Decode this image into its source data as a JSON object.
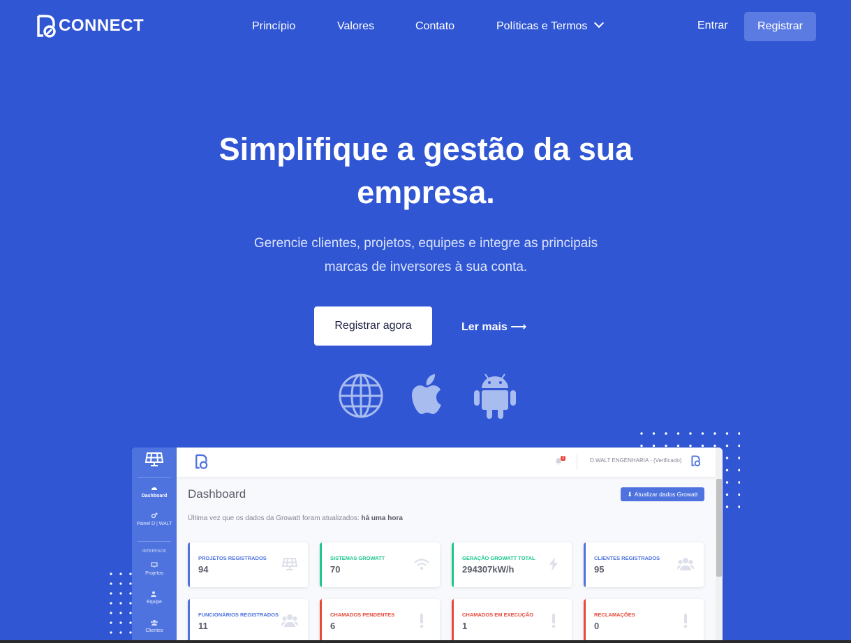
{
  "nav": {
    "logo_text": "CONNECT",
    "links": [
      "Princípio",
      "Valores",
      "Contato",
      "Políticas e Termos"
    ],
    "login_label": "Entrar",
    "register_label": "Registrar"
  },
  "hero": {
    "title_line1": "Simplifique a gestão da sua",
    "title_line2": "empresa.",
    "subtitle_line1": "Gerencie clientes, projetos, equipes e integre as principais",
    "subtitle_line2": "marcas de inversores à sua conta.",
    "cta_label": "Registrar agora",
    "more_label": "Ler mais ⟶",
    "platform_icons": [
      "globe-icon",
      "apple-icon",
      "android-icon"
    ]
  },
  "dashboard": {
    "sidebar": {
      "items": [
        {
          "label": "Dashboard",
          "icon": "gauge-icon"
        },
        {
          "label": "Painel D | WALT",
          "icon": "cogs-icon"
        }
      ],
      "heading": "INTERFACE",
      "interface_items": [
        {
          "label": "Projetos",
          "icon": "solar-panel-icon"
        },
        {
          "label": "Equipe",
          "icon": "team-icon"
        },
        {
          "label": "Clientes",
          "icon": "users-icon"
        }
      ]
    },
    "topbar": {
      "notification_count": "3",
      "user_name": "D.WALT ENGENHARIA - (Verificado)"
    },
    "title": "Dashboard",
    "update_button": "Atualizar dados Growatt",
    "last_update_text": "Última vez que os dados da Growatt foram atualizados:",
    "last_update_value": "há uma hora",
    "cards": [
      {
        "label": "PROJETOS REGISTRADOS",
        "value": "94",
        "color": "#4e73df",
        "icon": "solar-panel-icon"
      },
      {
        "label": "SISTEMAS GROWATT",
        "value": "70",
        "color": "#1cc88a",
        "icon": "wifi-icon"
      },
      {
        "label": "GERAÇÃO GROWATT TOTAL",
        "value": "294307kW/h",
        "color": "#1cc88a",
        "icon": "bolt-icon"
      },
      {
        "label": "CLIENTES REGISTRADOS",
        "value": "95",
        "color": "#4e73df",
        "icon": "users-icon"
      },
      {
        "label": "FUNCIONÁRIOS REGISTRADOS",
        "value": "11",
        "color": "#4e73df",
        "icon": "users-icon"
      },
      {
        "label": "CHAMADOS PENDENTES",
        "value": "6",
        "color": "#e74a3b",
        "icon": "exclamation-icon"
      },
      {
        "label": "CHAMADOS EM EXECUÇÃO",
        "value": "1",
        "color": "#e74a3b",
        "icon": "exclamation-icon"
      },
      {
        "label": "RECLAMAÇÕES",
        "value": "0",
        "color": "#e74a3b",
        "icon": "exclamation-icon"
      }
    ]
  },
  "colors": {
    "background": "#3056d3",
    "register_button": "#5b7be2",
    "panel_primary": "#4e73df",
    "success": "#1cc88a",
    "danger": "#e74a3b"
  }
}
